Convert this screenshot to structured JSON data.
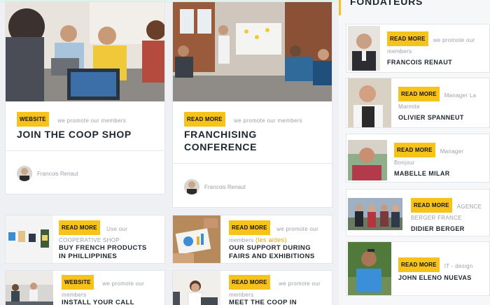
{
  "featured": [
    {
      "badge": "WEBSITE",
      "meta": "we promote our members",
      "title_lines": [
        "JOIN THE COOP SHOP"
      ],
      "author": "Francois Renaut"
    },
    {
      "badge": "READ MORE",
      "meta": "we promote our members",
      "title_lines": [
        "FRANCHISING",
        "CONFERENCE"
      ],
      "author": "Francois Renaut"
    }
  ],
  "small_cards": [
    {
      "badge": "READ MORE",
      "meta_lines": [
        "Use our",
        "COOPERATIVE SHOP"
      ],
      "title_lines": [
        "BUY FRENCH PRODUCTS",
        "IN PHILLIPPINES"
      ]
    },
    {
      "badge": "READ MORE",
      "meta_lines": [
        "we promote our"
      ],
      "meta_prefix": "members ",
      "meta_highlight": "(les aides)",
      "title_lines": [
        "OUR SUPPORT DURING",
        "FAIRS AND EXHIBITIONS"
      ]
    },
    {
      "badge": "WEBSITE",
      "meta_lines": [
        "we promote our",
        "members"
      ],
      "title_lines": [
        "INSTALL YOUR CALL"
      ]
    },
    {
      "badge": "READ MORE",
      "meta_lines": [
        "we promote our",
        "members"
      ],
      "title_lines": [
        "MEET THE COOP IN"
      ]
    }
  ],
  "sidebar": {
    "heading": "FONDATEURS",
    "founders": [
      {
        "badge": "READ MORE",
        "meta_lines": [
          "we promote our",
          "members"
        ],
        "name": "FRANCOIS RENAUT"
      },
      {
        "badge": "READ MORE",
        "meta_lines": [
          "Manager La",
          "Marmite"
        ],
        "name": "OLIVIER SPANNEUT"
      },
      {
        "badge": "READ MORE",
        "meta_lines": [
          "Manager",
          "Bonjour"
        ],
        "name": "MABELLE MILAR"
      },
      {
        "badge": "READ MORE",
        "meta_lines": [
          "AGENCE",
          "BERGER FRANCE"
        ],
        "name": "DIDIER BERGER"
      },
      {
        "badge": "READ MORE",
        "meta_lines": [
          "IT - design"
        ],
        "name": "JOHN ELENO NUEVAS"
      }
    ]
  }
}
